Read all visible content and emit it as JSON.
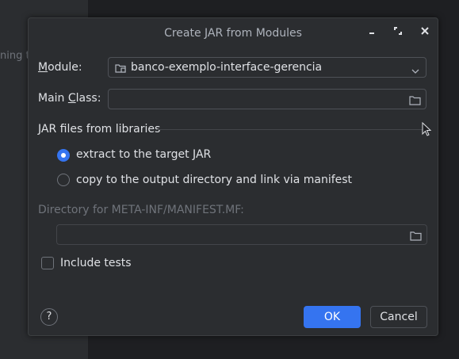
{
  "background": {
    "side_text": "ning to"
  },
  "dialog": {
    "title": "Create JAR from Modules",
    "window_buttons": {
      "minimize": "minimize-icon",
      "maximize": "maximize-icon",
      "close": "close-icon"
    },
    "module": {
      "label_prefix": "",
      "label_mnemonic": "M",
      "label_rest": "odule:",
      "value": "banco-exemplo-interface-gerencia"
    },
    "main_class": {
      "label_prefix": "Main ",
      "label_mnemonic": "C",
      "label_rest": "lass:",
      "value": ""
    },
    "jar_files_section": "JAR files from libraries",
    "radio_options": [
      {
        "label": "extract to the target JAR",
        "selected": true
      },
      {
        "label": "copy to the output directory and link via manifest",
        "selected": false
      }
    ],
    "manifest_dir": {
      "label": "Directory for META-INF/MANIFEST.MF:",
      "value": ""
    },
    "include_tests": {
      "label": "Include tests",
      "checked": false
    },
    "help_label": "?",
    "ok_label": "OK",
    "cancel_label": "Cancel"
  },
  "colors": {
    "accent": "#3574f0",
    "dialog_bg": "#2b2d30",
    "text": "#dfe1e5",
    "disabled_text": "#6f737a"
  }
}
